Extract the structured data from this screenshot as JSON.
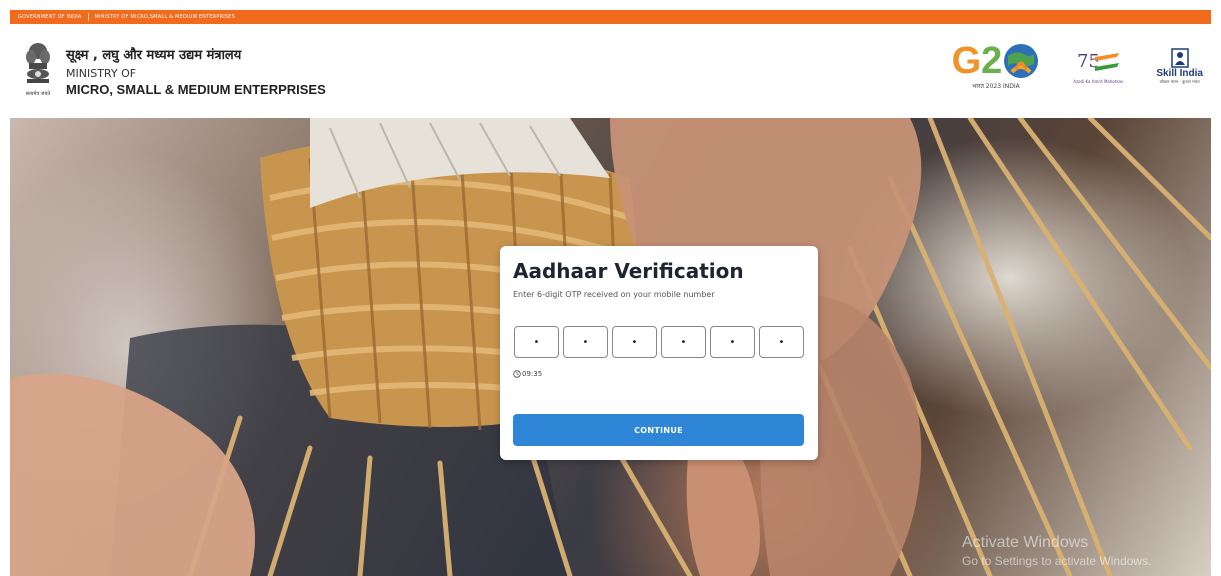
{
  "top_strip": {
    "left_text": "GOVERNMENT OF INDIA",
    "right_text": "MINISTRY OF MICRO,SMALL & MEDIUM ENTERPRISES"
  },
  "header": {
    "emblem_caption": "सत्यमेव जयते",
    "ministry_hindi": "सूक्ष्म , लघु और मध्यम उद्यम मंत्रालय",
    "ministry_en_line1": "MINISTRY OF",
    "ministry_en_line2": "MICRO, SMALL & MEDIUM ENTERPRISES"
  },
  "logos": {
    "g20_caption": "भारत 2023 INDIA",
    "azadi_caption": "Azadi Ka Amrit Mahotsav",
    "skill_india": "Skill India",
    "skill_caption": "कौशल भारत - कुशल भारत"
  },
  "modal": {
    "title": "Aadhaar Verification",
    "subtitle": "Enter 6-digit OTP received on your mobile number",
    "otp_digits": [
      "•",
      "•",
      "•",
      "•",
      "•",
      "•"
    ],
    "timer": "09:35",
    "continue_label": "CONTINUE"
  },
  "watermark": {
    "line1": "Activate Windows",
    "line2": "Go to Settings to activate Windows."
  },
  "colors": {
    "top_strip": "#f26b1d",
    "primary_button": "#2f86d6"
  }
}
